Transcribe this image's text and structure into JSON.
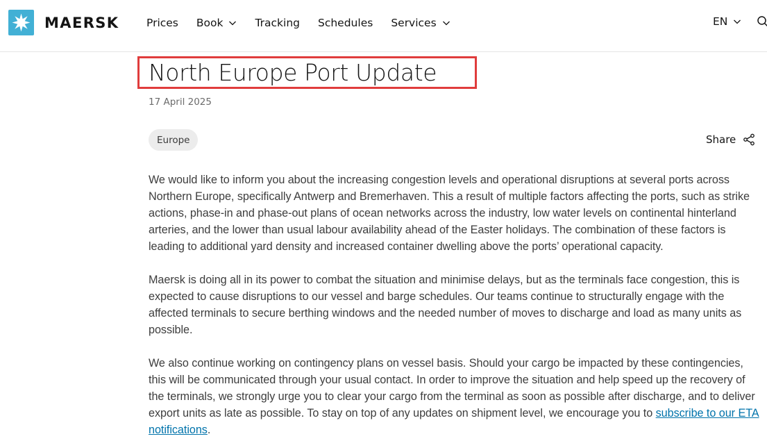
{
  "brand": {
    "name": "MAERSK",
    "color": "#42b0d5"
  },
  "nav": {
    "items": [
      {
        "label": "Prices",
        "dropdown": false
      },
      {
        "label": "Book",
        "dropdown": true
      },
      {
        "label": "Tracking",
        "dropdown": false
      },
      {
        "label": "Schedules",
        "dropdown": false
      },
      {
        "label": "Services",
        "dropdown": true
      }
    ],
    "language": "EN"
  },
  "article": {
    "title": "North Europe Port Update",
    "date": "17 April 2025",
    "tag": "Europe",
    "share_label": "Share",
    "paragraphs": [
      "We would like to inform you about the increasing congestion levels and operational disruptions at several ports across Northern Europe, specifically Antwerp and Bremerhaven. This a result of multiple factors affecting the ports, such as strike actions, phase-in and phase-out plans of ocean networks across the industry, low water levels on continental hinterland arteries, and the lower than usual labour availability ahead of the Easter holidays. The combination of these factors is leading to additional yard density and increased container dwelling above the ports’ operational capacity.",
      "Maersk is doing all in its power to combat the situation and minimise delays, but as the terminals face congestion, this is expected to cause disruptions to our vessel and barge schedules. Our teams continue to structurally engage with the affected terminals to secure berthing windows and the needed number of moves to discharge and load as many units as possible."
    ],
    "paragraph3_text": "We also continue working on contingency plans on vessel basis. Should your cargo be impacted by these contingencies, this will be communicated through your usual contact. In order to improve the situation and help speed up the recovery of the terminals, we strongly urge you to clear your cargo from the terminal as soon as possible after discharge, and to deliver export units as late as possible. To stay on top of any updates on shipment level, we encourage you to ",
    "paragraph3_link": "subscribe to our ETA notifications",
    "paragraph3_end": "."
  },
  "icons": {
    "logo": "star-icon",
    "chevron": "chevron-down-icon",
    "search": "search-icon",
    "share": "share-icon"
  },
  "colors": {
    "link": "#0073ab",
    "highlight_border": "#e03c3c"
  }
}
